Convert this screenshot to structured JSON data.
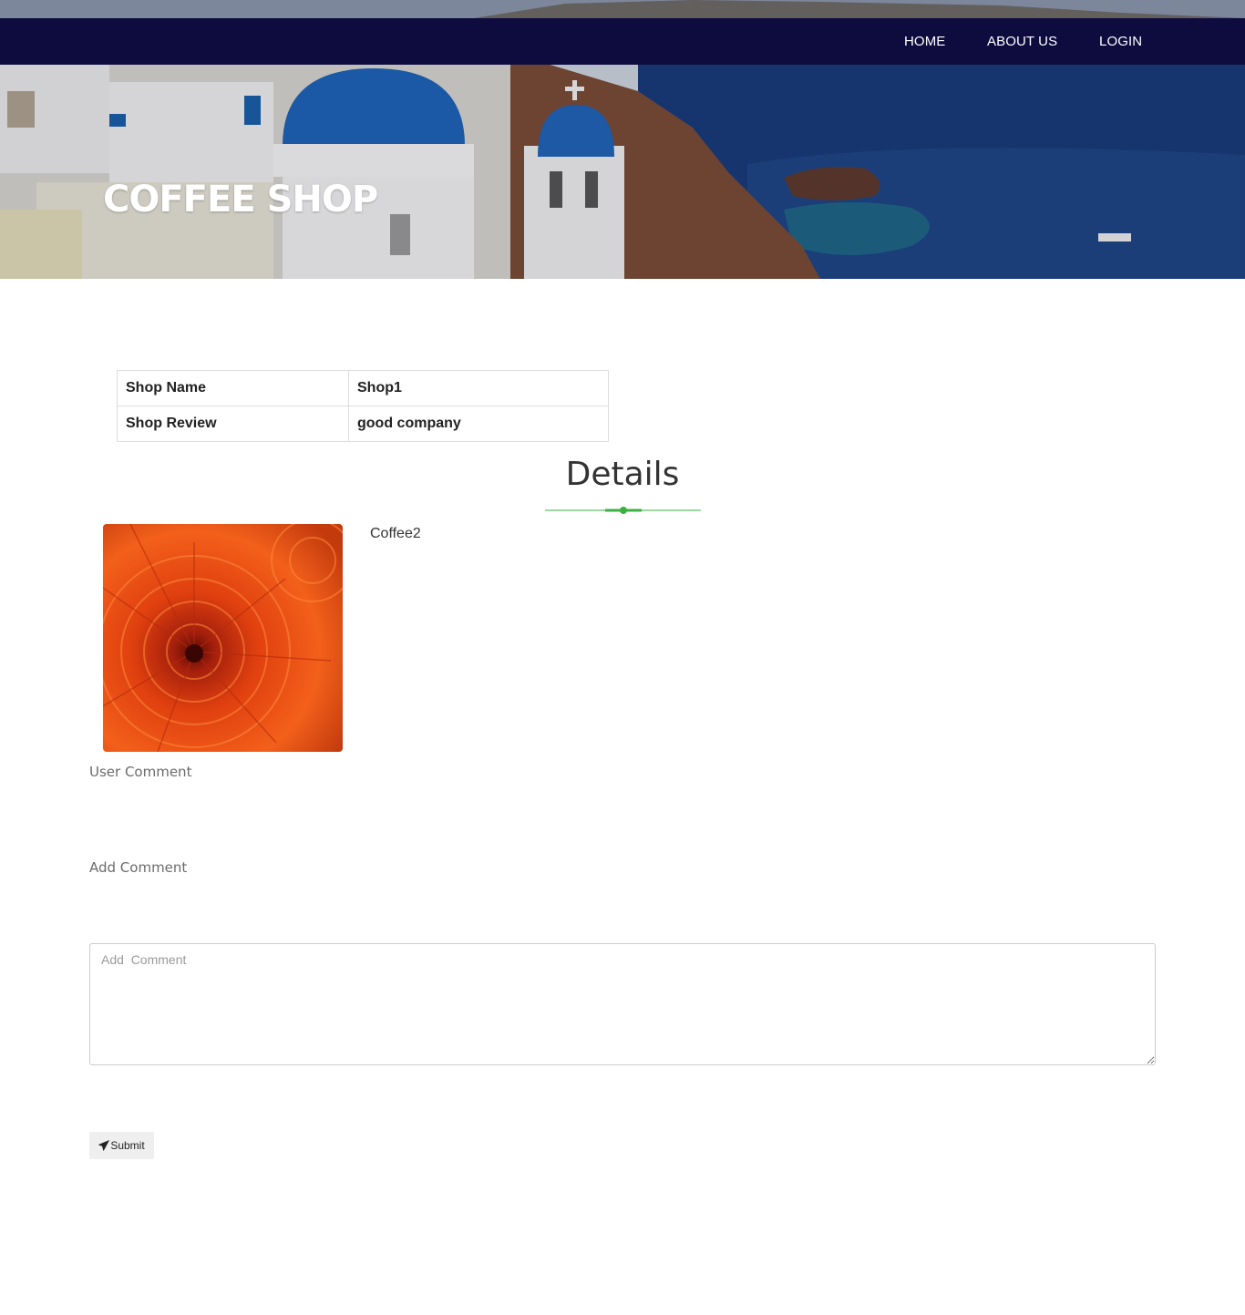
{
  "nav": {
    "items": [
      {
        "label": "HOME"
      },
      {
        "label": "ABOUT US"
      },
      {
        "label": "LOGIN"
      }
    ]
  },
  "hero": {
    "title": "COFFEE SHOP"
  },
  "shop_info": {
    "rows": [
      {
        "key": "Shop Name",
        "value": "Shop1"
      },
      {
        "key": "Shop Review",
        "value": "good company"
      }
    ]
  },
  "details": {
    "title": "Details",
    "product_name": "Coffee2",
    "product_image_icon": "flower-photo",
    "accent_color": "#3cb043"
  },
  "comments": {
    "user_comment_label": "User Comment",
    "add_comment_label": "Add Comment",
    "input_placeholder": "Add  Comment",
    "input_value": "",
    "submit_label": "Submit",
    "submit_icon": "paper-plane-icon"
  },
  "colors": {
    "navbar": "#0e0c3f",
    "nav_text": "#ffffff"
  }
}
